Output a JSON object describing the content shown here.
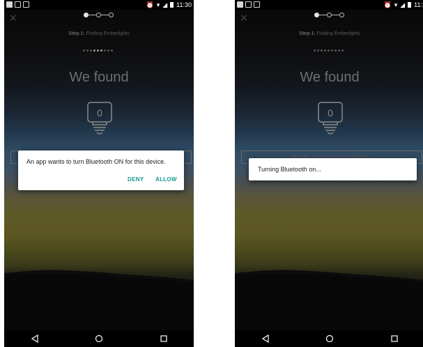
{
  "status_bar": {
    "time_left": "11:30",
    "time_right": "11:3"
  },
  "onboarding": {
    "step_label_bold": "Step 1:",
    "step_label_rest": " Finding Emberlights",
    "heading": "We found",
    "bulb_count": "0",
    "bar_text_right": "GREAT, YOU FOUND THEM ALL"
  },
  "dialog_left": {
    "message": "An app wants to turn Bluetooth ON for this device.",
    "deny_label": "DENY",
    "allow_label": "ALLOW"
  },
  "dialog_right": {
    "message": "Turning Bluetooth on..."
  },
  "colors": {
    "accent": "#159a8e",
    "dialog_bg": "#ffffff",
    "dialog_text": "#212121"
  },
  "icons": {
    "close": "×",
    "back": "back-triangle-icon",
    "home": "home-circle-icon",
    "recents": "recents-square-icon"
  }
}
